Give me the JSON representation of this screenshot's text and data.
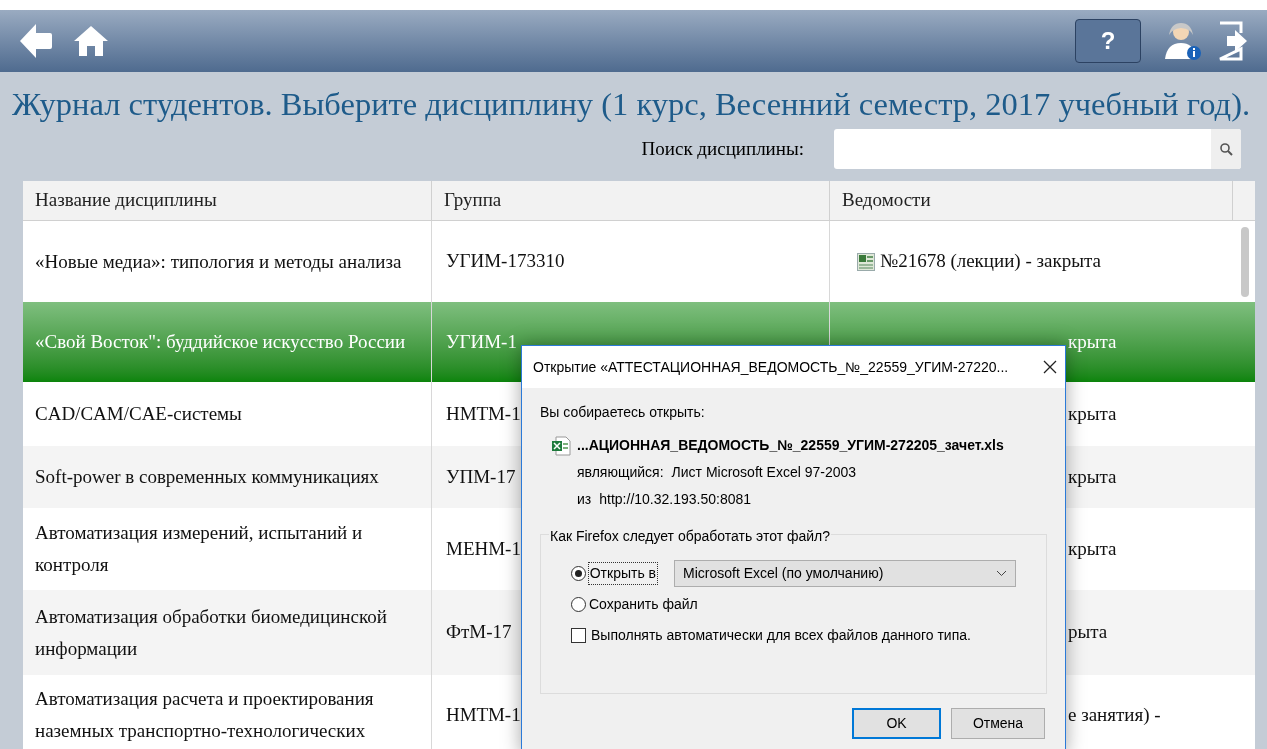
{
  "toolbar": {
    "help_label": "?"
  },
  "title": "Журнал студентов. Выберите дисциплину (1 курс, Весенний семестр, 2017 учебный год).",
  "search": {
    "label": "Поиск дисциплины:"
  },
  "table": {
    "columns": [
      "Название дисциплины",
      "Группа",
      "Ведомости"
    ],
    "rows": [
      {
        "name": "«Новые медиа»: типология и методы анализа",
        "group": "УГИМ-173310",
        "sheet": {
          "kind": "file",
          "text": "№21678 (лекции) - закрыта"
        },
        "selected": false
      },
      {
        "name": "«Свой Восток\": буддийское искусство России",
        "group": "УГИМ-1",
        "sheet": {
          "kind": "clipped",
          "text": "крыта"
        },
        "selected": true
      },
      {
        "name": "CAD/CAM/CAE-системы",
        "group": "НМТМ-1",
        "sheet": {
          "kind": "clipped",
          "text": "крыта"
        },
        "selected": false
      },
      {
        "name": "Soft-power в современных коммуникациях",
        "group": "УПМ-17",
        "sheet": {
          "kind": "clipped",
          "text": "крыта"
        },
        "selected": false
      },
      {
        "name": "Автоматизация измерений, испытаний и контроля",
        "group": "МЕНМ-1",
        "sheet": {
          "kind": "clipped",
          "text": "крыта"
        },
        "selected": false
      },
      {
        "name": "Автоматизация обработки биомедицинской информации",
        "group": "ФтМ-17",
        "sheet": {
          "kind": "clipped",
          "text": "рыта"
        },
        "selected": false
      },
      {
        "name": "Автоматизация расчета и проектирования наземных транспортно-технологических",
        "group": "НМТМ-1",
        "sheet": {
          "kind": "clipped",
          "text": "е занятия) -"
        },
        "selected": false
      }
    ]
  },
  "dialog": {
    "title": "Открытие «АТТЕСТАЦИОННАЯ_ВЕДОМОСТЬ_№_22559_УГИМ-27220...",
    "intro": "Вы собираетесь открыть:",
    "file_name": "...АЦИОННАЯ_ВЕДОМОСТЬ_№_22559_УГИМ-272205_зачет.xls",
    "type_label": "являющийся:",
    "type_value": "Лист Microsoft Excel 97-2003",
    "from_label": "из",
    "from_value": "http://10.32.193.50:8081",
    "group_label": "Как Firefox следует обработать этот файл?",
    "options": [
      {
        "label": "Открыть в",
        "selected": true
      },
      {
        "label": "Сохранить файл",
        "selected": false
      }
    ],
    "app_select": "Microsoft Excel (по умолчанию)",
    "auto": {
      "label": "Выполнять автоматически для всех файлов данного типа.",
      "checked": false
    },
    "buttons": [
      "OK",
      "Отмена"
    ]
  }
}
